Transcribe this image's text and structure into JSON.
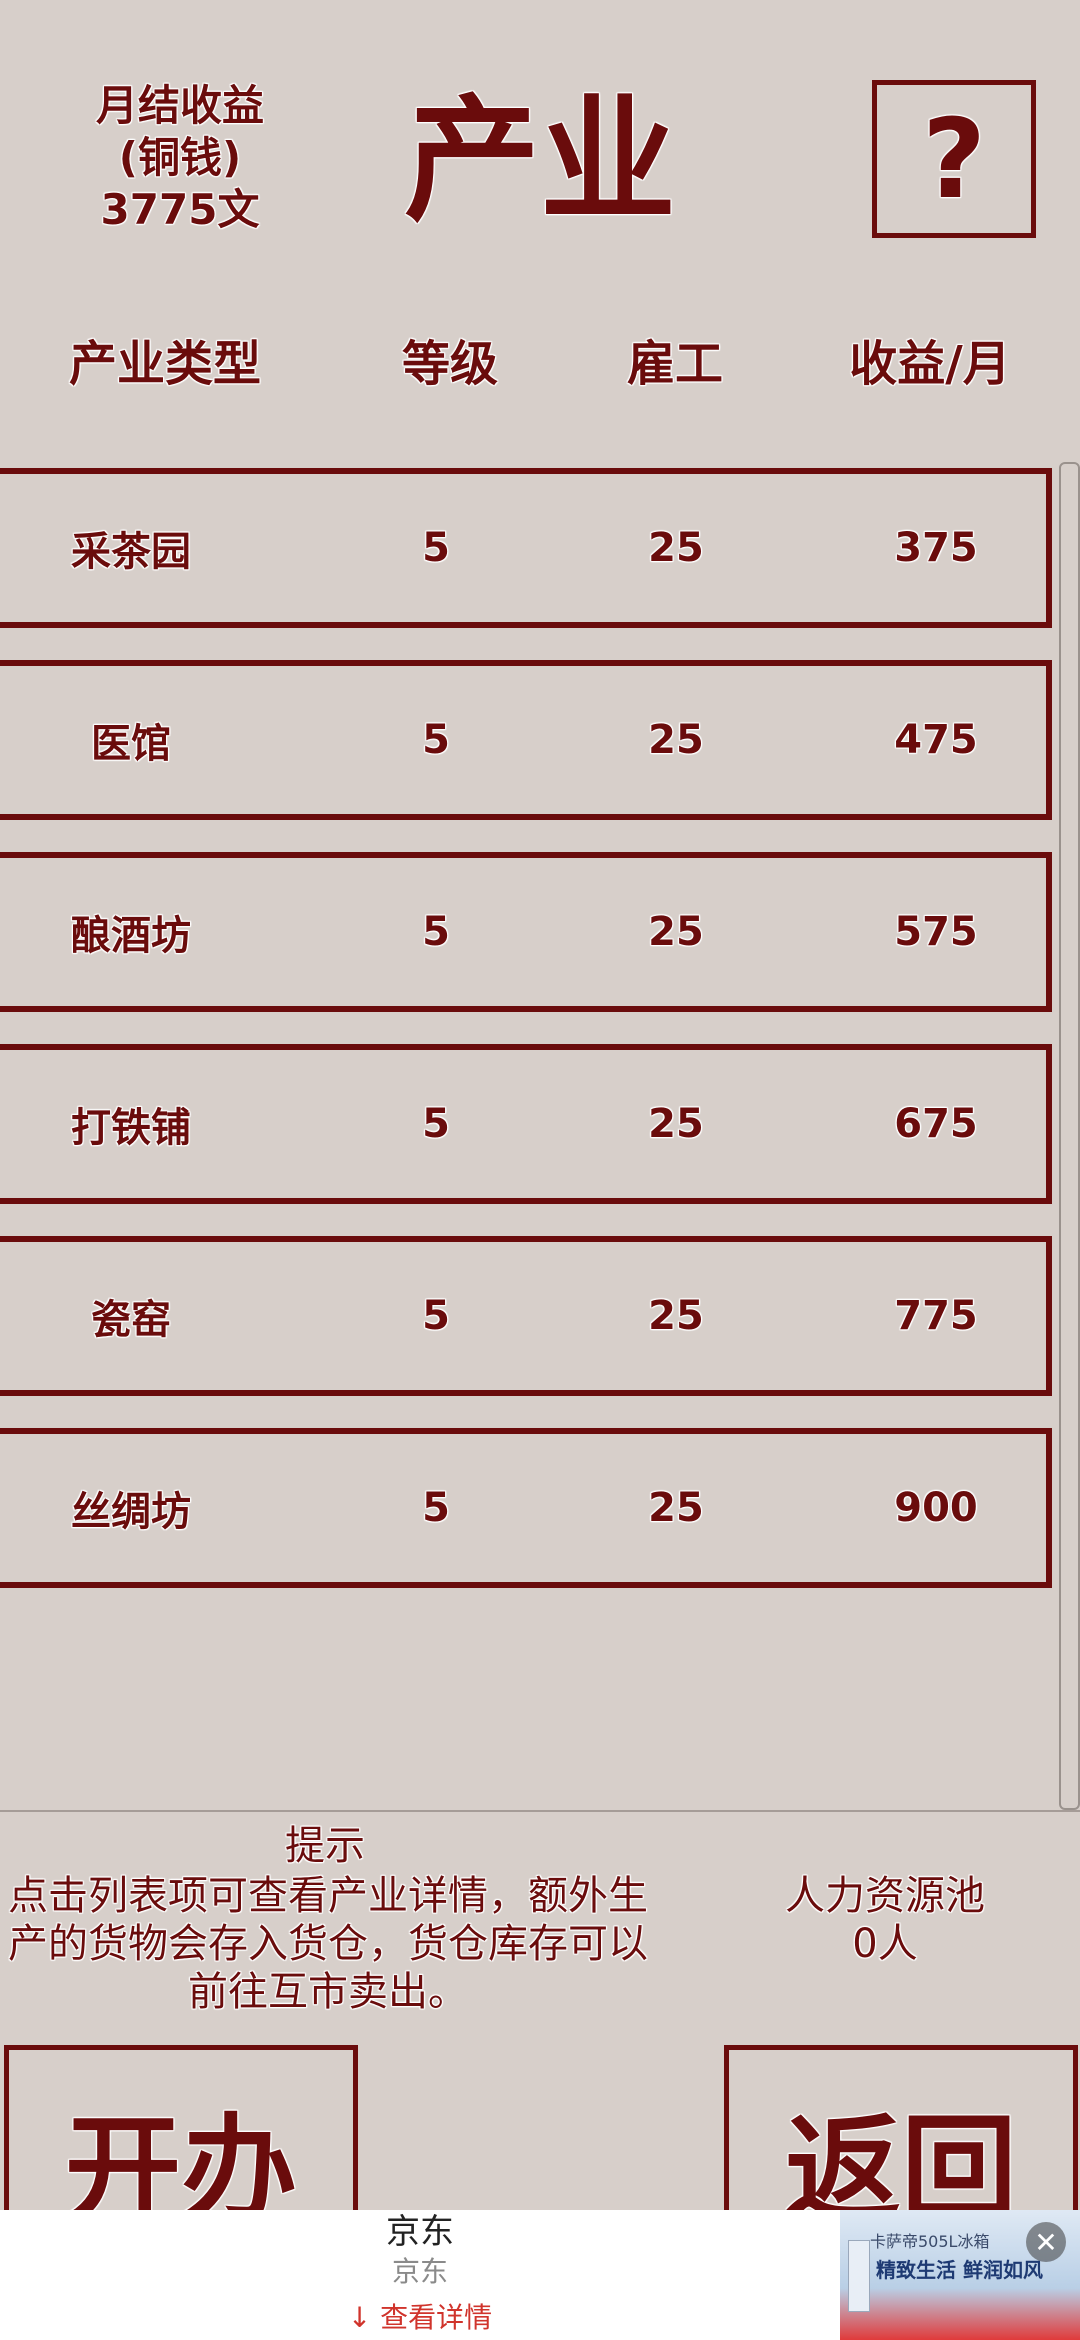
{
  "header": {
    "income_label": "月结收益",
    "income_unit": "(铜钱)",
    "income_value": "3775文",
    "title": "产业",
    "help_label": "?"
  },
  "columns": [
    "产业类型",
    "等级",
    "雇工",
    "收益/月"
  ],
  "industries": [
    {
      "name": "采茶园",
      "level": "5",
      "workers": "25",
      "income": "375"
    },
    {
      "name": "医馆",
      "level": "5",
      "workers": "25",
      "income": "475"
    },
    {
      "name": "酿酒坊",
      "level": "5",
      "workers": "25",
      "income": "575"
    },
    {
      "name": "打铁铺",
      "level": "5",
      "workers": "25",
      "income": "675"
    },
    {
      "name": "瓷窑",
      "level": "5",
      "workers": "25",
      "income": "775"
    },
    {
      "name": "丝绸坊",
      "level": "5",
      "workers": "25",
      "income": "900"
    }
  ],
  "tip": {
    "title": "提示",
    "line1": "点击列表项可查看产业详情，额外生",
    "line2": "产的货物会存入货仓，货仓库存可以",
    "line3": "前往互市卖出。"
  },
  "pool": {
    "label": "人力资源池",
    "value": "0人"
  },
  "buttons": {
    "open": "开办",
    "back": "返回"
  },
  "ad": {
    "title": "京东",
    "subtitle": "京东",
    "cta": "↓ 查看详情",
    "image_line1": "卡萨帝505L冰箱",
    "image_line2": "精致生活 鲜润如风",
    "close_icon": "close-icon"
  },
  "colors": {
    "background": "#d7cfca",
    "accent": "#6a0c0c"
  }
}
